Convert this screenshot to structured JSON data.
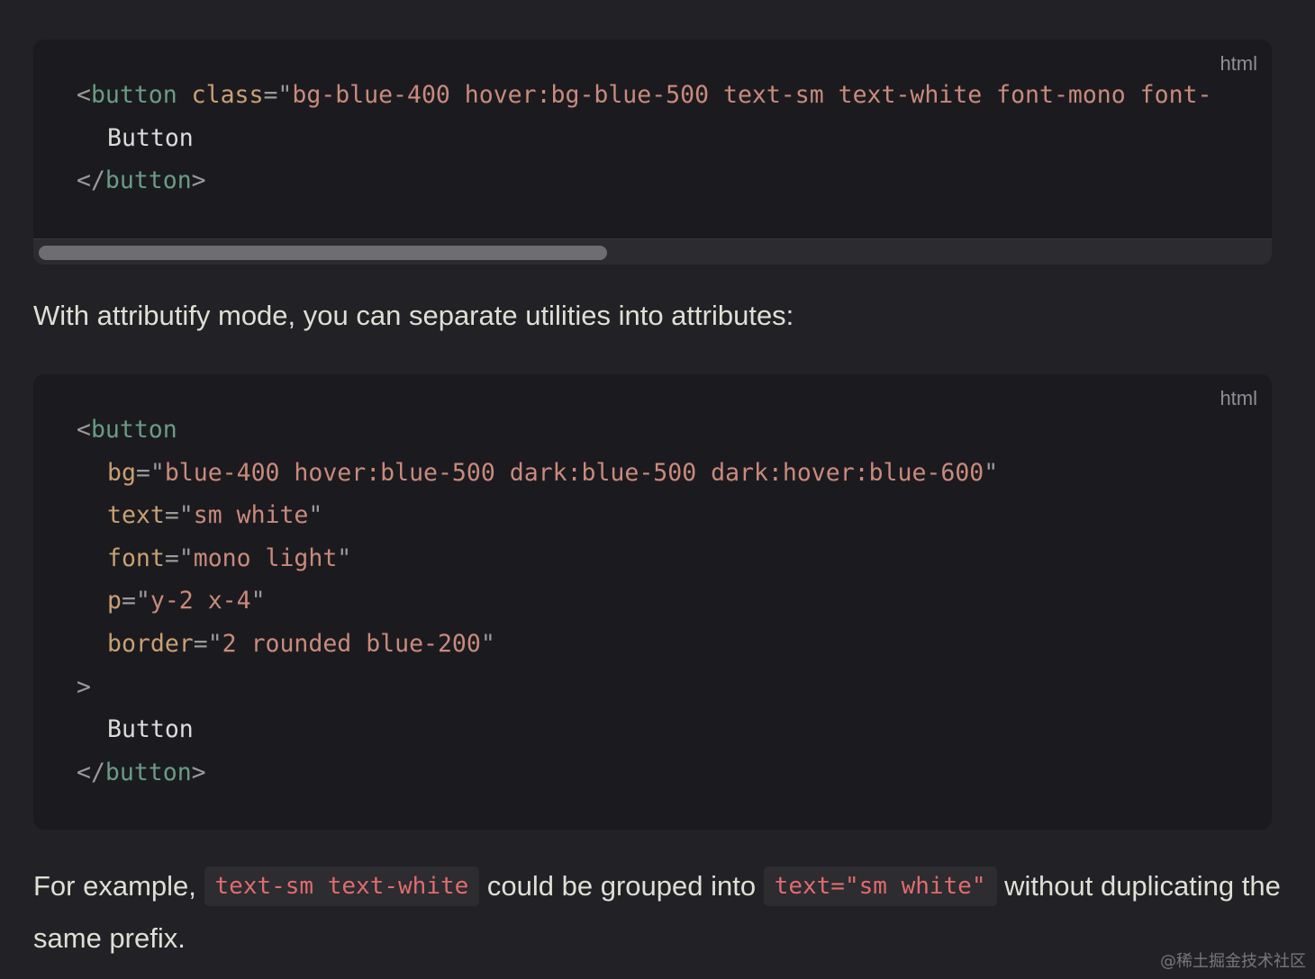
{
  "code_block_1": {
    "language": "html",
    "lines": {
      "l1_open": "<",
      "l1_tag": "button",
      "l1_attr": " class",
      "l1_eq": "=\"",
      "l1_str": "bg-blue-400 hover:bg-blue-500 text-sm text-white font-mono font-",
      "l2_text": "Button",
      "l3_open": "</",
      "l3_tag": "button",
      "l3_close": ">"
    }
  },
  "paragraph_1": "With attributify mode, you can separate utilities into attributes:",
  "code_block_2": {
    "language": "html",
    "lines": {
      "l1_open": "<",
      "l1_tag": "button",
      "bg_attr": "bg",
      "bg_val": "blue-400 hover:blue-500 dark:blue-500 dark:hover:blue-600",
      "text_attr": "text",
      "text_val": "sm white",
      "font_attr": "font",
      "font_val": "mono light",
      "p_attr": "p",
      "p_val": "y-2 x-4",
      "border_attr": "border",
      "border_val": "2 rounded blue-200",
      "close_gt": ">",
      "content": "Button",
      "end_open": "</",
      "end_tag": "button",
      "end_close": ">"
    },
    "eq_quote": "=\"",
    "quote": "\""
  },
  "paragraph_2": {
    "part1": "For example, ",
    "code1": "text-sm text-white",
    "part2": " could be grouped into ",
    "code2": "text=\"sm white\"",
    "part3": " without duplicating the same prefix."
  },
  "watermark": "@稀土掘金技术社区"
}
